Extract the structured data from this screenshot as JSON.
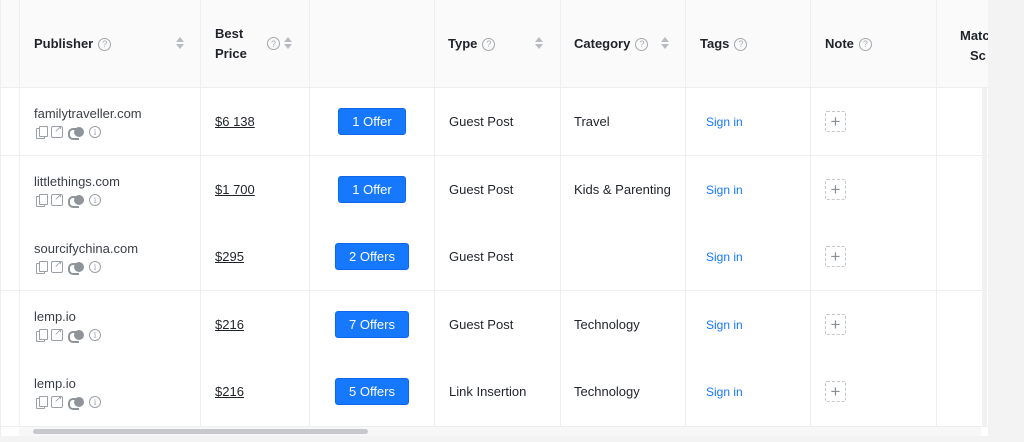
{
  "columns": {
    "publisher": "Publisher",
    "best_price_line1": "Best",
    "best_price_line2": "Price",
    "offers": "",
    "type": "Type",
    "category": "Category",
    "tags": "Tags",
    "note": "Note",
    "match_line1": "Matc",
    "match_line2": "Sc"
  },
  "help_glyph": "?",
  "info_glyph": "i",
  "note_add_glyph": "+",
  "rows": [
    {
      "publisher": "familytraveller.com",
      "price": "$6 138",
      "offers": "1 Offer",
      "type": "Guest Post",
      "category": "Travel",
      "tags": "Sign in"
    },
    {
      "publisher": "littlethings.com",
      "price": "$1 700",
      "offers": "1 Offer",
      "type": "Guest Post",
      "category": "Kids & Parenting",
      "tags": "Sign in"
    },
    {
      "publisher": "sourcifychina.com",
      "price": "$295",
      "offers": "2 Offers",
      "type": "Guest Post",
      "category": "",
      "tags": "Sign in"
    },
    {
      "publisher": "lemp.io",
      "price": "$216",
      "offers": "7 Offers",
      "type": "Guest Post",
      "category": "Technology",
      "tags": "Sign in"
    },
    {
      "publisher": "lemp.io",
      "price": "$216",
      "offers": "5 Offers",
      "type": "Link Insertion",
      "category": "Technology",
      "tags": "Sign in"
    }
  ],
  "colors": {
    "accent": "#1677ff",
    "header_bg": "#fafafa",
    "border": "#eceff2"
  }
}
